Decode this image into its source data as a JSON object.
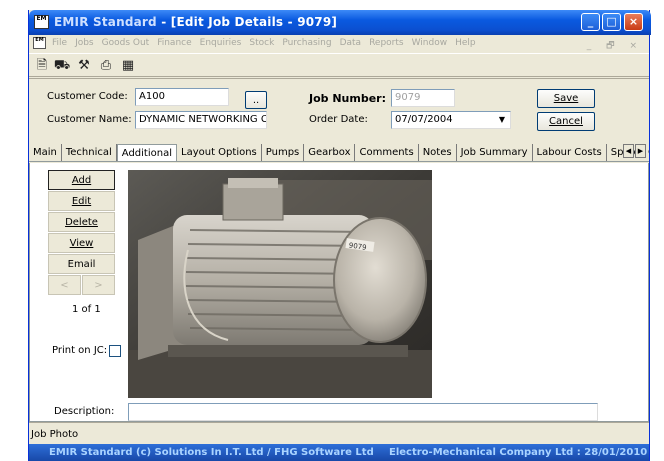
{
  "window": {
    "title_app": "EMIR Standard",
    "title_doc": " - [Edit Job Details - 9079]",
    "app_icon_text": "EM",
    "buttons": [
      "minimize",
      "maximize",
      "close"
    ]
  },
  "menu": {
    "items": [
      "File",
      "Jobs",
      "Goods Out",
      "Finance",
      "Enquiries",
      "Stock",
      "Purchasing",
      "Data",
      "Reports",
      "Window",
      "Help"
    ],
    "mdi_controls": "_ 🗗 ×"
  },
  "toolbar": {
    "icons": [
      "document-icon",
      "vehicle-icon",
      "tools-icon",
      "printer-icon",
      "calculator-icon"
    ]
  },
  "form": {
    "customer_code_label": "Customer Code:",
    "customer_code_value": "A100",
    "lookup_button": "..",
    "customer_name_label": "Customer Name:",
    "customer_name_value": "DYNAMIC NETWORKING C",
    "job_number_label": "Job Number:",
    "job_number_value": "9079",
    "order_date_label": "Order Date:",
    "order_date_value": "07/07/2004",
    "save_button": "Save",
    "cancel_button": "Cancel"
  },
  "tabs": [
    "Main",
    "Technical",
    "Additional",
    "Layout Options",
    "Pumps",
    "Gearbox",
    "Comments",
    "Notes",
    "Job Summary",
    "Labour Costs",
    "Spares C"
  ],
  "active_tab": "Additional",
  "photo_panel": {
    "buttons": {
      "add": "Add",
      "edit": "Edit",
      "delete": "Delete",
      "view": "View",
      "email": "Email",
      "prev": "<",
      "next": ">"
    },
    "counter": "1 of 1",
    "print_label": "Print on JC:",
    "photo_tag": "9079",
    "description_label": "Description:",
    "description_value": ""
  },
  "status": {
    "text": "Job Photo"
  },
  "footer": {
    "left": "EMIR Standard (c) Solutions In I.T. Ltd / FHG Software Ltd",
    "right": "Electro-Mechanical Company Ltd : 28/01/2010"
  }
}
